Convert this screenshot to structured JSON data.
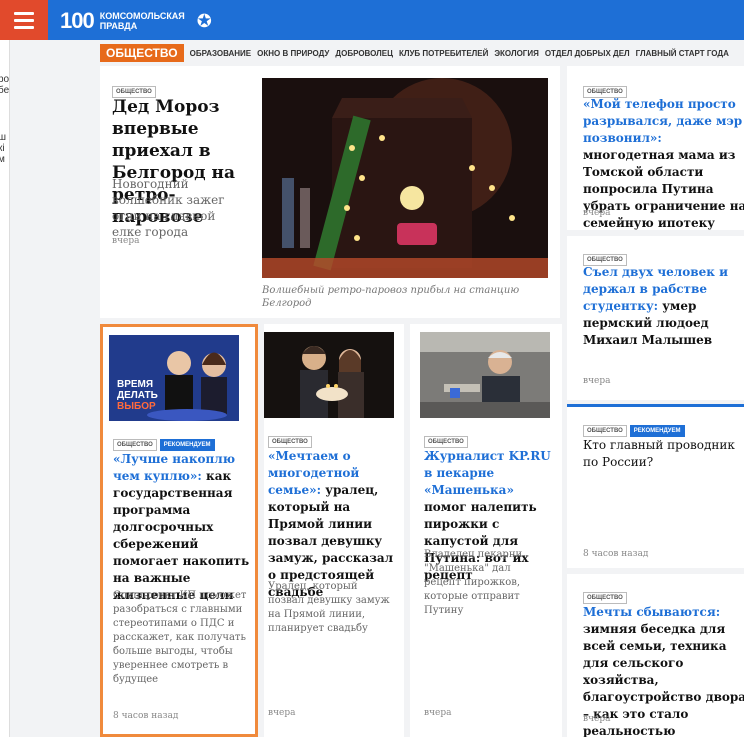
{
  "header": {
    "logo_mark": "100",
    "logo_line1": "КОМСОМОЛЬСКАЯ",
    "logo_line2": "ПРАВДА"
  },
  "left_sliver": [
    "ро",
    "бе",
    "ш",
    "кі",
    "м"
  ],
  "section_nav": {
    "active": "ОБЩЕСТВО",
    "links": [
      "ОБРАЗОВАНИЕ",
      "ОКНО В ПРИРОДУ",
      "ДОБРОВОЛЕЦ",
      "КЛУБ ПОТРЕБИТЕЛЕЙ",
      "ЭКОЛОГИЯ",
      "ОТДЕЛ ДОБРЫХ ДЕЛ",
      "ГЛАВНЫЙ СТАРТ ГОДА"
    ]
  },
  "main_story": {
    "tag": "ОБЩЕСТВО",
    "headline": "Дед Мороз впервые приехал в Белгород на ретро-паровозе",
    "lead": "Новогодний волшебник зажег огни на главной елке города",
    "time": "вчера",
    "caption": "Волшебный ретро-паровоз прибыл на станцию Белгород"
  },
  "right_stories": [
    {
      "tag": "ОБЩЕСТВО",
      "headline_blue": "«Мой телефон просто разрывался, даже мэр позвонил»:",
      "headline_rest": " многодетная мама из Томской области попросила Путина убрать ограничение на семейную ипотеку",
      "time": "вчера"
    },
    {
      "tag": "ОБЩЕСТВО",
      "headline_blue": "Съел двух человек и держал в рабстве студентку:",
      "headline_rest": " умер пермский людоед Михаил Малышев",
      "time": "вчера"
    },
    {
      "tag": "ОБЩЕСТВО",
      "tag2": "РЕКОМЕНДУЕМ",
      "headline_blue": "",
      "headline_rest": "Кто главный проводник по России?",
      "time": "8 часов назад"
    },
    {
      "tag": "ОБЩЕСТВО",
      "headline_blue": "Мечты сбываются:",
      "headline_rest": " зимняя беседка для всей семьи, техника для сельского хозяйства, благоустройство двора – как это стало реальностью",
      "time": "вчера"
    }
  ],
  "bottom_stories": [
    {
      "tag": "ОБЩЕСТВО",
      "tag2": "РЕКОМЕНДУЕМ",
      "promo_line1": "ВРЕМЯ",
      "promo_line2": "ДЕЛАТЬ",
      "promo_line3": "ВЫБОР",
      "headline_blue": "«Лучше накоплю чем куплю»:",
      "headline_rest": " как государственная программа долгосрочных сбережений помогает накопить на важные жизненные цели",
      "lead": "Спецпроект КП поможет разобраться с главными стереотипами о ПДС и расскажет, как получать больше выгоды, чтобы увереннее смотреть в будущее",
      "time": "8 часов назад"
    },
    {
      "tag": "ОБЩЕСТВО",
      "headline_blue": "«Мечтаем о многодетной семье»:",
      "headline_rest": " уралец, который на Прямой линии позвал девушку замуж, рассказал о предстоящей свадьбе",
      "lead": "Уралец, который позвал девушку замуж на Прямой линии, планирует свадьбу",
      "time": "вчера"
    },
    {
      "tag": "ОБЩЕСТВО",
      "headline_blue": "Журналист KP.RU в пекарне «Машенька»",
      "headline_rest": " помог налепить пирожки с капустой для Путина: вот их рецепт",
      "lead": "Владелец пекарни \"Машенька\" дал рецепт пирожков, которые отправит Путину",
      "time": "вчера"
    }
  ],
  "colors": {
    "brand_blue": "#1e6fd6",
    "menu_red": "#e14a2c",
    "section_orange": "#e76a1a",
    "highlight_orange": "#f08a3c"
  }
}
